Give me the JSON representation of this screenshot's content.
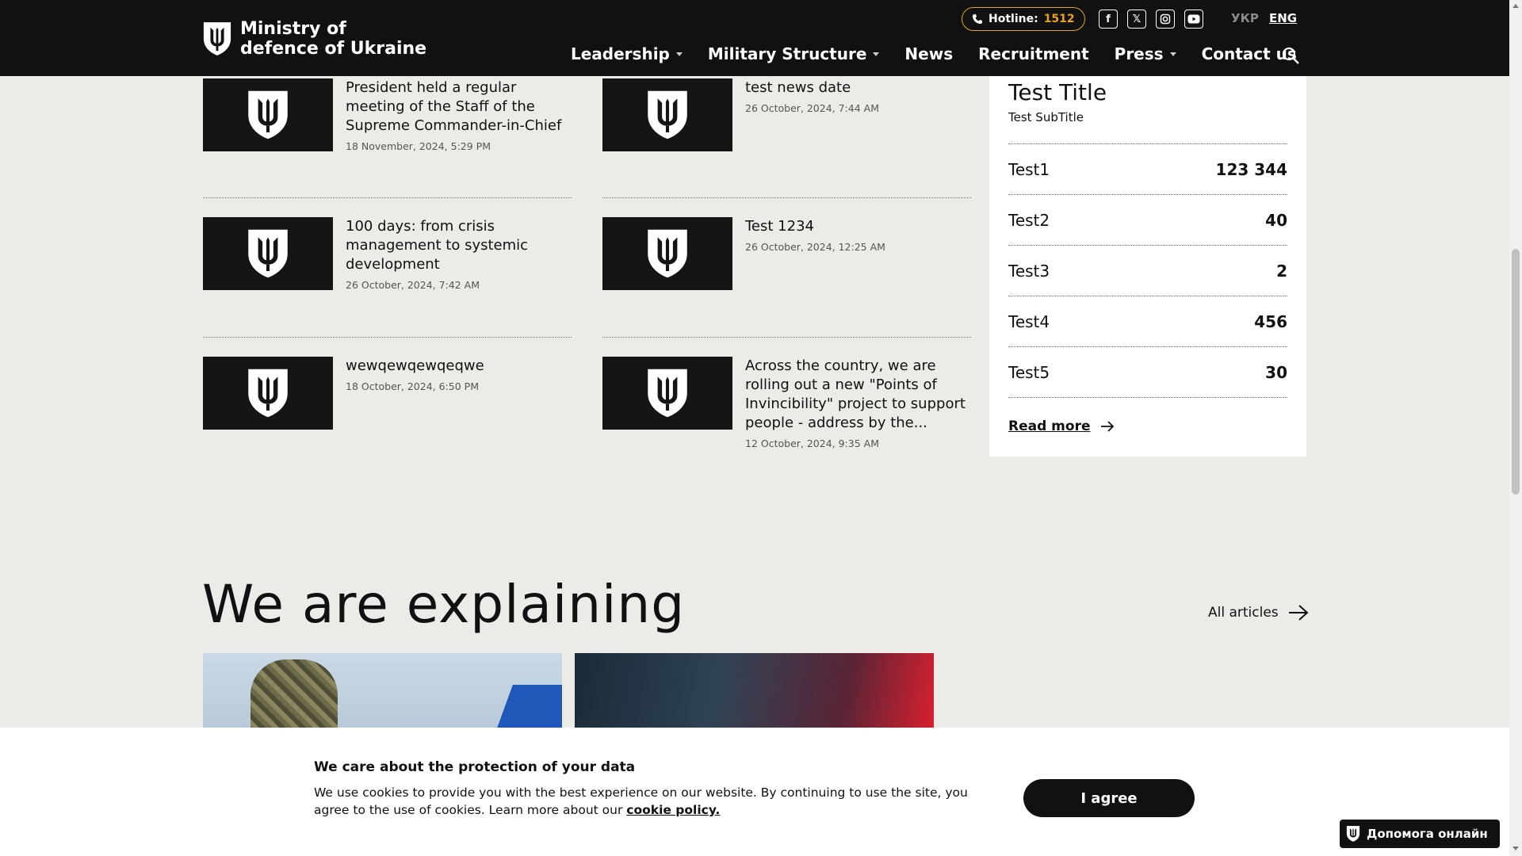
{
  "header": {
    "logo_line1": "Ministry of",
    "logo_line2": "defence of Ukraine",
    "hotline_label": "Hotline:",
    "hotline_number": "1512",
    "social": [
      "facebook",
      "x",
      "instagram",
      "youtube"
    ],
    "lang_ukr": "УКР",
    "lang_eng": "ENG",
    "nav": [
      "Leadership",
      "Military Structure",
      "News",
      "Recruitment",
      "Press",
      "Contact us"
    ]
  },
  "news": [
    {
      "title": "President held a regular meeting of the Staff of the Supreme Commander-in-Chief",
      "date": "18 November, 2024, 5:29 PM"
    },
    {
      "title": "test news date",
      "date": "26 October, 2024, 7:44 AM"
    },
    {
      "title": "100 days: from crisis management to systemic development",
      "date": "26 October, 2024, 7:42 AM"
    },
    {
      "title": "Test 1234",
      "date": "26 October, 2024, 12:25 AM"
    },
    {
      "title": "wewqewqewqeqwe",
      "date": "18 October, 2024, 6:50 PM"
    },
    {
      "title": "Across the country, we are rolling out a new \"Points of Invincibility\" project to support people - address by the...",
      "date": "12 October, 2024, 9:35 AM"
    }
  ],
  "stats": {
    "title": "Test Title",
    "subtitle": "Test SubTitle",
    "rows": [
      {
        "label": "Test1",
        "value": "123 344"
      },
      {
        "label": "Test2",
        "value": "40"
      },
      {
        "label": "Test3",
        "value": "2"
      },
      {
        "label": "Test4",
        "value": "456"
      },
      {
        "label": "Test5",
        "value": "30"
      }
    ],
    "read_more": "Read more"
  },
  "section": {
    "title": "We are explaining",
    "all_articles": "All articles"
  },
  "cookie": {
    "heading": "We care about the protection of your data",
    "text": "We use cookies to provide you with the best experience on our website. By continuing to use the site, you agree to the use of cookies. Learn more about our ",
    "link": "cookie policy.",
    "agree": "I agree"
  },
  "help_button": "Допомога онлайн",
  "colors": {
    "accent": "#e8a21c",
    "header_bg": "#111111",
    "page_bg": "#edebe7"
  }
}
